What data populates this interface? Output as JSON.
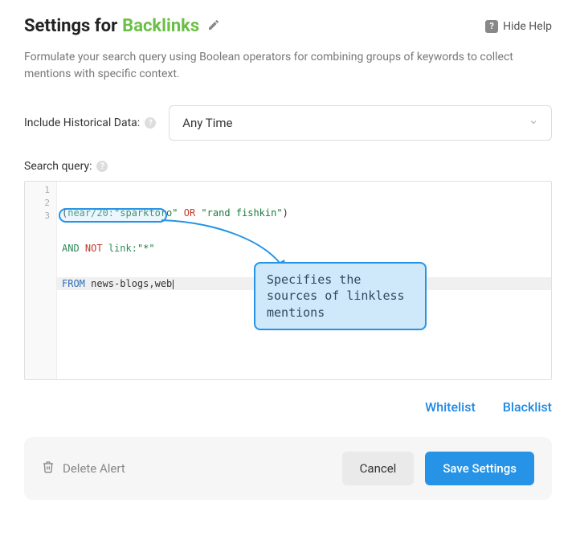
{
  "header": {
    "title_prefix": "Settings for",
    "title_accent": "Backlinks",
    "hide_help": "Hide Help"
  },
  "description": "Formulate your search query using Boolean operators for combining groups of keywords to collect mentions with specific context.",
  "historical": {
    "label": "Include Historical Data:",
    "value": "Any Time"
  },
  "query": {
    "label": "Search query:",
    "lines": [
      "1",
      "2",
      "3"
    ],
    "line1": {
      "open": "(",
      "near": "near/20:",
      "str1": "\"sparktoro\"",
      "or": " OR ",
      "str2": "\"rand fishkin\"",
      "close": ")"
    },
    "line2": {
      "and": "AND",
      "not": " NOT ",
      "link": "link:",
      "val": "\"*\""
    },
    "line3": {
      "from": "FROM",
      "rest": " news-blogs,web"
    }
  },
  "callout": "Specifies the sources of linkless mentions",
  "links": {
    "whitelist": "Whitelist",
    "blacklist": "Blacklist"
  },
  "footer": {
    "delete": "Delete Alert",
    "cancel": "Cancel",
    "save": "Save Settings"
  }
}
